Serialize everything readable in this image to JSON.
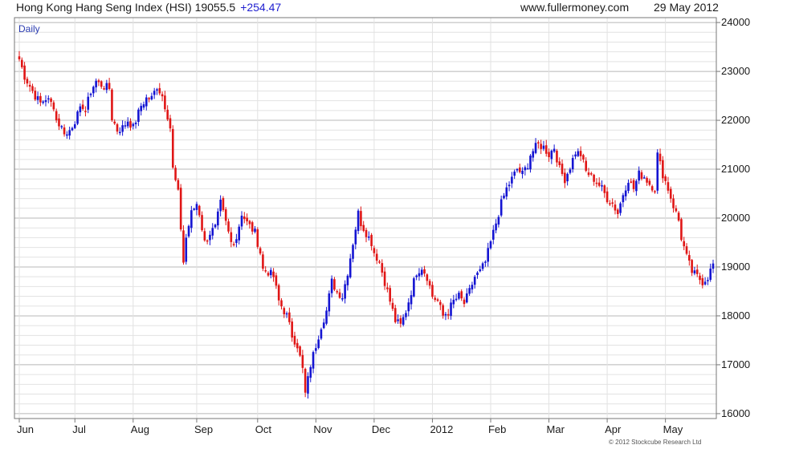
{
  "header": {
    "title": "Hong Kong Hang Seng Index (HSI) 19055.5",
    "change": "+254.47",
    "site": "www.fullermoney.com",
    "date": "29 May 2012"
  },
  "colors": {
    "up": "#1414d2",
    "down": "#e01616",
    "grid": "#d0d0d0",
    "frame": "#777777"
  },
  "chart_data": {
    "type": "ohlc-bar",
    "period_label": "Daily",
    "ylim": [
      15900,
      24100
    ],
    "yticks": [
      16000,
      17000,
      18000,
      19000,
      20000,
      21000,
      22000,
      23000,
      24000
    ],
    "ygrid_step": 200,
    "x_ticks": [
      "Jun",
      "Jul",
      "Aug",
      "Sep",
      "Oct",
      "Nov",
      "Dec",
      "2012",
      "Feb",
      "Mar",
      "Apr",
      "May"
    ],
    "close_series": [
      [
        0,
        23250
      ],
      [
        2,
        22900
      ],
      [
        4,
        22700
      ],
      [
        6,
        22500
      ],
      [
        8,
        22350
      ],
      [
        10,
        22450
      ],
      [
        13,
        22300
      ],
      [
        14,
        22000
      ],
      [
        16,
        21850
      ],
      [
        18,
        21700
      ],
      [
        20,
        21900
      ],
      [
        22,
        22100
      ],
      [
        24,
        22300
      ],
      [
        25,
        22200
      ],
      [
        27,
        22600
      ],
      [
        29,
        22800
      ],
      [
        30,
        22750
      ],
      [
        32,
        22700
      ],
      [
        34,
        22650
      ],
      [
        35,
        22050
      ],
      [
        37,
        21800
      ],
      [
        39,
        21850
      ],
      [
        41,
        22000
      ],
      [
        43,
        21850
      ],
      [
        46,
        22300
      ],
      [
        48,
        22450
      ],
      [
        50,
        22450
      ],
      [
        52,
        22700
      ],
      [
        54,
        22500
      ],
      [
        56,
        22100
      ],
      [
        57,
        21850
      ],
      [
        58,
        21000
      ],
      [
        60,
        20500
      ],
      [
        62,
        19100
      ],
      [
        63,
        19600
      ],
      [
        65,
        20100
      ],
      [
        67,
        20300
      ],
      [
        68,
        20100
      ],
      [
        70,
        19500
      ],
      [
        72,
        19700
      ],
      [
        74,
        19800
      ],
      [
        76,
        20300
      ],
      [
        78,
        19900
      ],
      [
        80,
        19500
      ],
      [
        82,
        19600
      ],
      [
        84,
        20100
      ],
      [
        86,
        19900
      ],
      [
        89,
        19700
      ],
      [
        91,
        19300
      ],
      [
        92,
        18950
      ],
      [
        94,
        18900
      ],
      [
        96,
        18800
      ],
      [
        98,
        18300
      ],
      [
        101,
        18000
      ],
      [
        102,
        17800
      ],
      [
        103,
        17600
      ],
      [
        105,
        17400
      ],
      [
        107,
        16900
      ],
      [
        108,
        16400
      ],
      [
        110,
        17000
      ],
      [
        112,
        17400
      ],
      [
        114,
        17800
      ],
      [
        116,
        18100
      ],
      [
        118,
        18700
      ],
      [
        120,
        18500
      ],
      [
        122,
        18400
      ],
      [
        124,
        18900
      ],
      [
        126,
        19500
      ],
      [
        128,
        20100
      ],
      [
        129,
        19900
      ],
      [
        131,
        19700
      ],
      [
        133,
        19500
      ],
      [
        134,
        19300
      ],
      [
        136,
        19100
      ],
      [
        138,
        18700
      ],
      [
        140,
        18300
      ],
      [
        142,
        17900
      ],
      [
        144,
        17800
      ],
      [
        146,
        18100
      ],
      [
        148,
        18500
      ],
      [
        150,
        18900
      ],
      [
        152,
        19000
      ],
      [
        154,
        18800
      ],
      [
        156,
        18400
      ],
      [
        158,
        18300
      ],
      [
        160,
        18000
      ],
      [
        162,
        18100
      ],
      [
        164,
        18300
      ],
      [
        166,
        18400
      ],
      [
        168,
        18250
      ],
      [
        170,
        18500
      ],
      [
        172,
        18800
      ],
      [
        174,
        18900
      ],
      [
        176,
        19100
      ],
      [
        178,
        19500
      ],
      [
        180,
        19900
      ],
      [
        182,
        20300
      ],
      [
        184,
        20600
      ],
      [
        186,
        20800
      ],
      [
        188,
        21000
      ],
      [
        190,
        20900
      ],
      [
        192,
        21100
      ],
      [
        193,
        21300
      ],
      [
        195,
        21450
      ],
      [
        196,
        21500
      ],
      [
        198,
        21450
      ],
      [
        200,
        21300
      ],
      [
        202,
        21450
      ],
      [
        204,
        21000
      ],
      [
        206,
        20800
      ],
      [
        208,
        21050
      ],
      [
        210,
        21350
      ],
      [
        212,
        21300
      ],
      [
        214,
        20950
      ],
      [
        216,
        20850
      ],
      [
        218,
        20750
      ],
      [
        220,
        20600
      ],
      [
        222,
        20400
      ],
      [
        224,
        20300
      ],
      [
        226,
        20100
      ],
      [
        228,
        20500
      ],
      [
        230,
        20800
      ],
      [
        232,
        20600
      ],
      [
        234,
        20900
      ],
      [
        236,
        20850
      ],
      [
        238,
        20700
      ],
      [
        240,
        20600
      ],
      [
        241,
        21300
      ],
      [
        243,
        20900
      ],
      [
        245,
        20600
      ],
      [
        247,
        20250
      ],
      [
        249,
        19950
      ],
      [
        250,
        19600
      ],
      [
        252,
        19200
      ],
      [
        254,
        18900
      ],
      [
        256,
        18800
      ],
      [
        258,
        18700
      ],
      [
        260,
        18800
      ],
      [
        262,
        19055
      ]
    ]
  },
  "credit": "© 2012 Stockcube Research Ltd"
}
